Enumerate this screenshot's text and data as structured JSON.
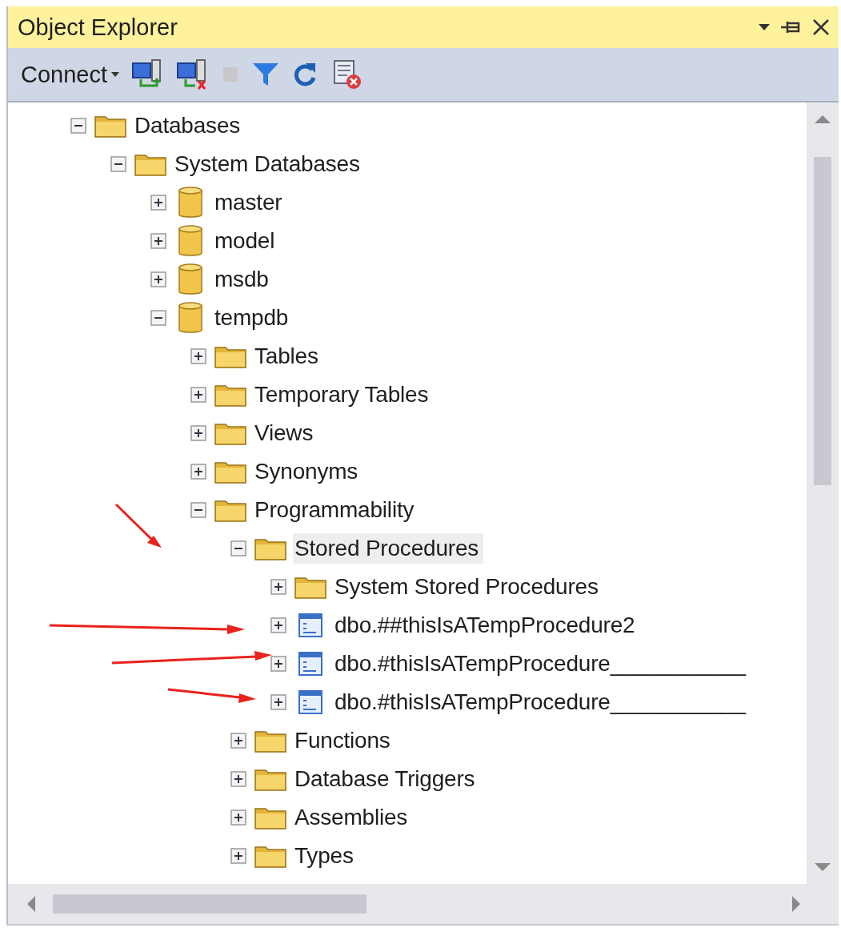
{
  "panel": {
    "title": "Object Explorer"
  },
  "toolbar": {
    "connect_label": "Connect"
  },
  "tree": [
    {
      "label": "Databases",
      "kind": "folder",
      "expanded": true,
      "selected": false,
      "children": [
        {
          "label": "System Databases",
          "kind": "folder",
          "expanded": true,
          "selected": false,
          "children": [
            {
              "label": "master",
              "kind": "database",
              "expanded": false,
              "selected": false
            },
            {
              "label": "model",
              "kind": "database",
              "expanded": false,
              "selected": false
            },
            {
              "label": "msdb",
              "kind": "database",
              "expanded": false,
              "selected": false
            },
            {
              "label": "tempdb",
              "kind": "database",
              "expanded": true,
              "selected": false,
              "children": [
                {
                  "label": "Tables",
                  "kind": "folder",
                  "expanded": false,
                  "selected": false
                },
                {
                  "label": "Temporary Tables",
                  "kind": "folder",
                  "expanded": false,
                  "selected": false
                },
                {
                  "label": "Views",
                  "kind": "folder",
                  "expanded": false,
                  "selected": false
                },
                {
                  "label": "Synonyms",
                  "kind": "folder",
                  "expanded": false,
                  "selected": false
                },
                {
                  "label": "Programmability",
                  "kind": "folder",
                  "expanded": true,
                  "selected": false,
                  "children": [
                    {
                      "label": "Stored Procedures",
                      "kind": "folder",
                      "expanded": true,
                      "selected": true,
                      "children": [
                        {
                          "label": "System Stored Procedures",
                          "kind": "folder",
                          "expanded": false,
                          "selected": false
                        },
                        {
                          "label": "dbo.##thisIsATempProcedure2",
                          "kind": "procedure",
                          "expanded": false,
                          "selected": false
                        },
                        {
                          "label": "dbo.#thisIsATempProcedure___________",
                          "kind": "procedure",
                          "expanded": false,
                          "selected": false
                        },
                        {
                          "label": "dbo.#thisIsATempProcedure___________",
                          "kind": "procedure",
                          "expanded": false,
                          "selected": false
                        }
                      ]
                    },
                    {
                      "label": "Functions",
                      "kind": "folder",
                      "expanded": false,
                      "selected": false
                    },
                    {
                      "label": "Database Triggers",
                      "kind": "folder",
                      "expanded": false,
                      "selected": false
                    },
                    {
                      "label": "Assemblies",
                      "kind": "folder",
                      "expanded": false,
                      "selected": false
                    },
                    {
                      "label": "Types",
                      "kind": "folder",
                      "expanded": false,
                      "selected": false
                    }
                  ]
                }
              ]
            }
          ]
        }
      ]
    }
  ]
}
